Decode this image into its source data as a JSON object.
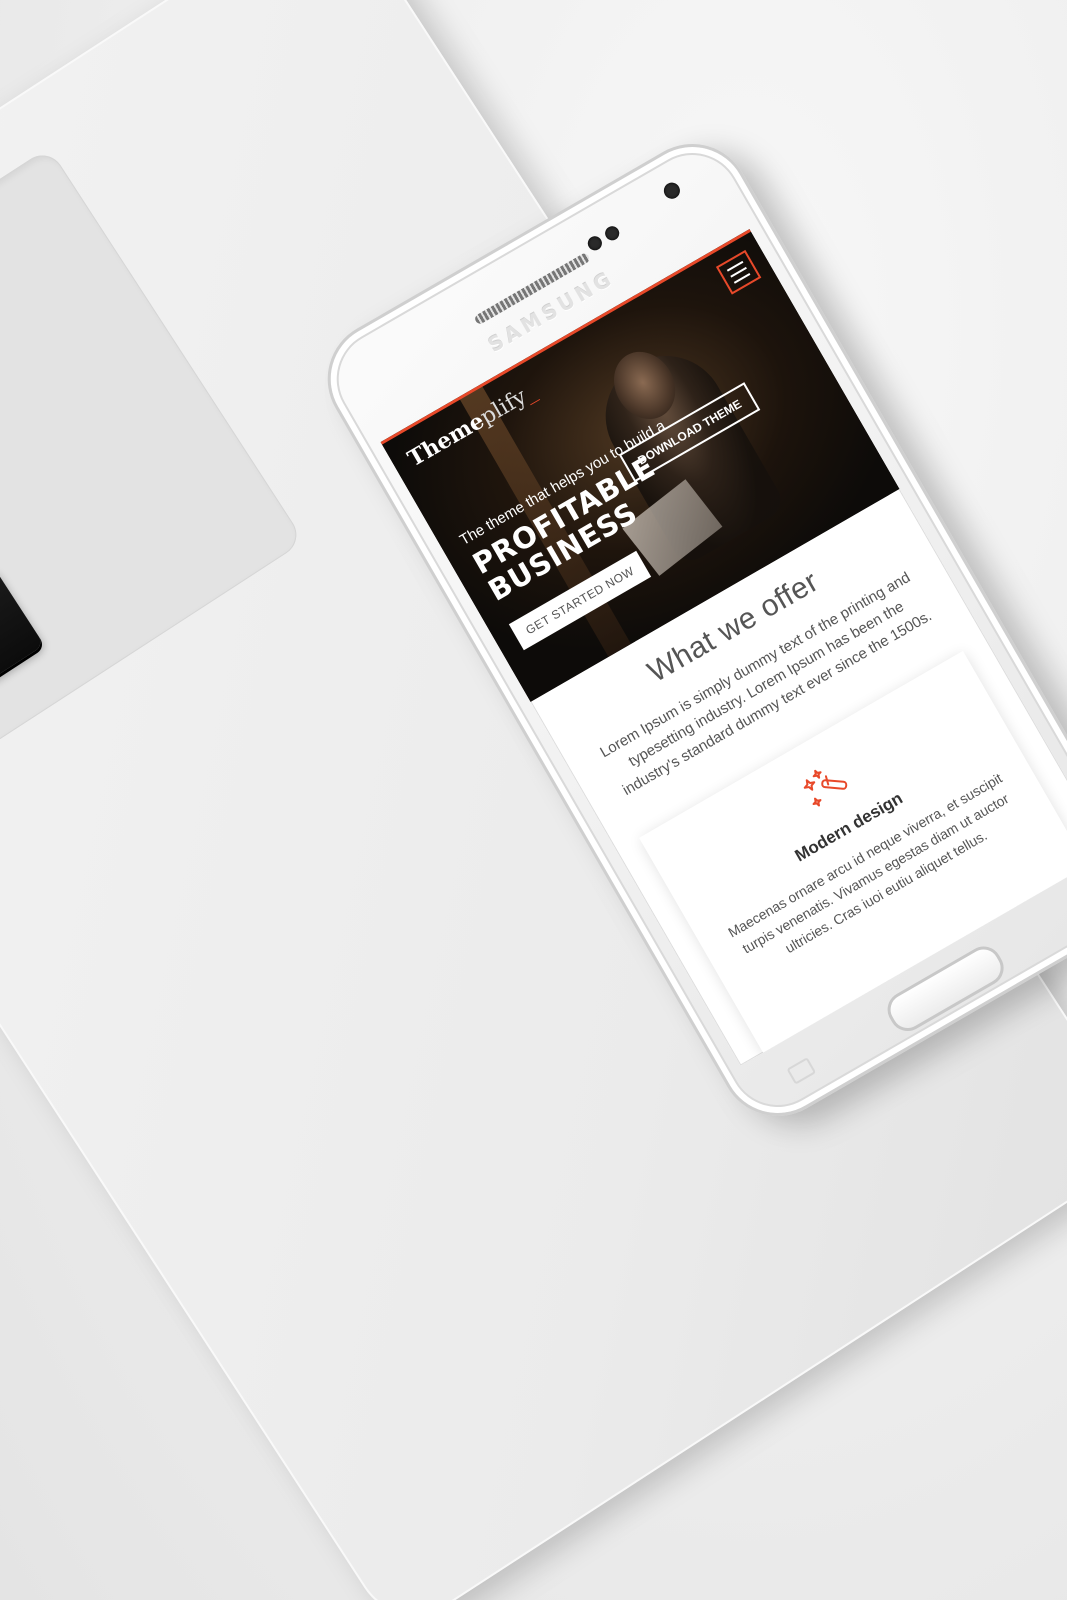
{
  "phone": {
    "brand": "SAMSUNG"
  },
  "site": {
    "logo_bold": "Theme",
    "logo_light": "plify",
    "logo_cursor": "_",
    "accent_color": "#e8492a"
  },
  "hero": {
    "kicker": "The theme that helps you to build a",
    "title_line1": "PROFITABLE",
    "title_line2": "BUSINESS",
    "primary_button": "GET STARTED NOW",
    "secondary_button": "DOWNLOAD THEME"
  },
  "offer": {
    "title": "What we offer",
    "text": "Lorem Ipsum is simply dummy text of the printing and typesetting industry. Lorem Ipsum has been the industry's standard dummy text ever since the 1500s."
  },
  "feature": {
    "icon": "magic-wand-icon",
    "title": "Modern design",
    "text": "Maecenas ornare arcu id neque viverra, et suscipit turpis venenatis. Vivamus egestas diam ut auctor ultricies. Cras iuoi eutiu aliquet tellus."
  },
  "laptop": {
    "keys": {
      "shift": "⇧",
      "eject": "⏏",
      "arrow_right": "►",
      "arrow_down": "▼"
    }
  }
}
